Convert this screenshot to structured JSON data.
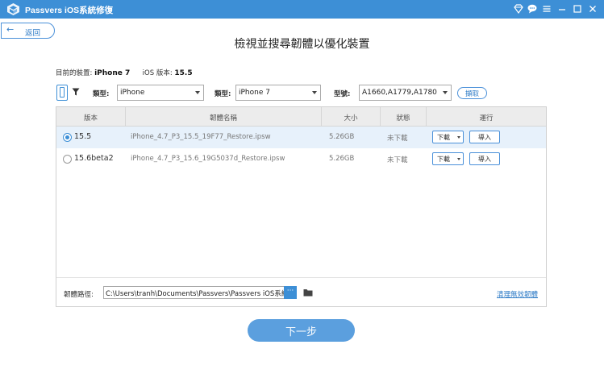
{
  "app": {
    "title": "Passvers iOS系統修復"
  },
  "nav": {
    "back_label": "返回"
  },
  "page": {
    "title": "檢視並搜尋韌體以優化裝置"
  },
  "device": {
    "current_label": "目前的裝置:",
    "current_value": "iPhone 7",
    "ios_label": "iOS 版本:",
    "ios_value": "15.5"
  },
  "filters": {
    "type_label": "類型:",
    "type_value": "iPhone",
    "kind_label": "類型:",
    "kind_value": "iPhone 7",
    "model_label": "型號:",
    "model_value": "A1660,A1779,A1780",
    "extract_label": "擷取"
  },
  "table": {
    "columns": [
      "版本",
      "韌體名稱",
      "大小",
      "狀態",
      "運行"
    ],
    "rows": [
      {
        "version": "15.5",
        "name": "iPhone_4.7_P3_15.5_19F77_Restore.ipsw",
        "size": "5.26GB",
        "status": "未下載",
        "download": "下載",
        "import": "導入",
        "selected": true
      },
      {
        "version": "15.6beta2",
        "name": "iPhone_4.7_P3_15.6_19G5037d_Restore.ipsw",
        "size": "5.26GB",
        "status": "未下載",
        "download": "下載",
        "import": "導入",
        "selected": false
      }
    ]
  },
  "path": {
    "label": "韌體路徑:",
    "value": "C:\\Users\\tranh\\Documents\\Passvers\\Passvers iOS系統修",
    "browse_label": "···",
    "clean_label": "清理無效韌體"
  },
  "footer": {
    "next_label": "下一步"
  },
  "colors": {
    "accent": "#3d8fd6",
    "button": "#5b9fde",
    "selected_row": "#e7f1fb"
  },
  "icons": [
    "app-logo-icon",
    "diamond-icon",
    "chat-icon",
    "menu-icon",
    "minimize-icon",
    "maximize-icon",
    "close-icon",
    "back-arrow-icon",
    "phone-icon",
    "filter-icon",
    "folder-icon"
  ]
}
